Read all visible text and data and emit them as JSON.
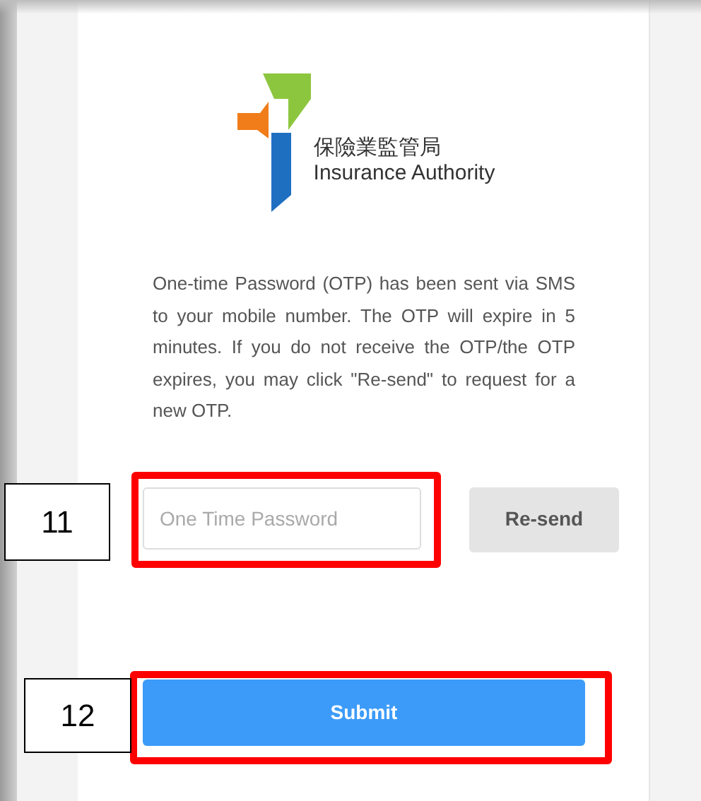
{
  "logo": {
    "name_zh": "保險業監管局",
    "name_en": "Insurance Authority"
  },
  "message": "One-time Password (OTP) has been sent via SMS to your mobile number. The OTP will expire in 5 minutes. If you do not receive the OTP/the OTP expires, you may click \"Re-send\" to request for a new OTP.",
  "otp_field": {
    "placeholder": "One Time Password"
  },
  "resend_button": "Re-send",
  "submit_button": "Submit",
  "callouts": [
    {
      "label": "11"
    },
    {
      "label": "12"
    }
  ]
}
